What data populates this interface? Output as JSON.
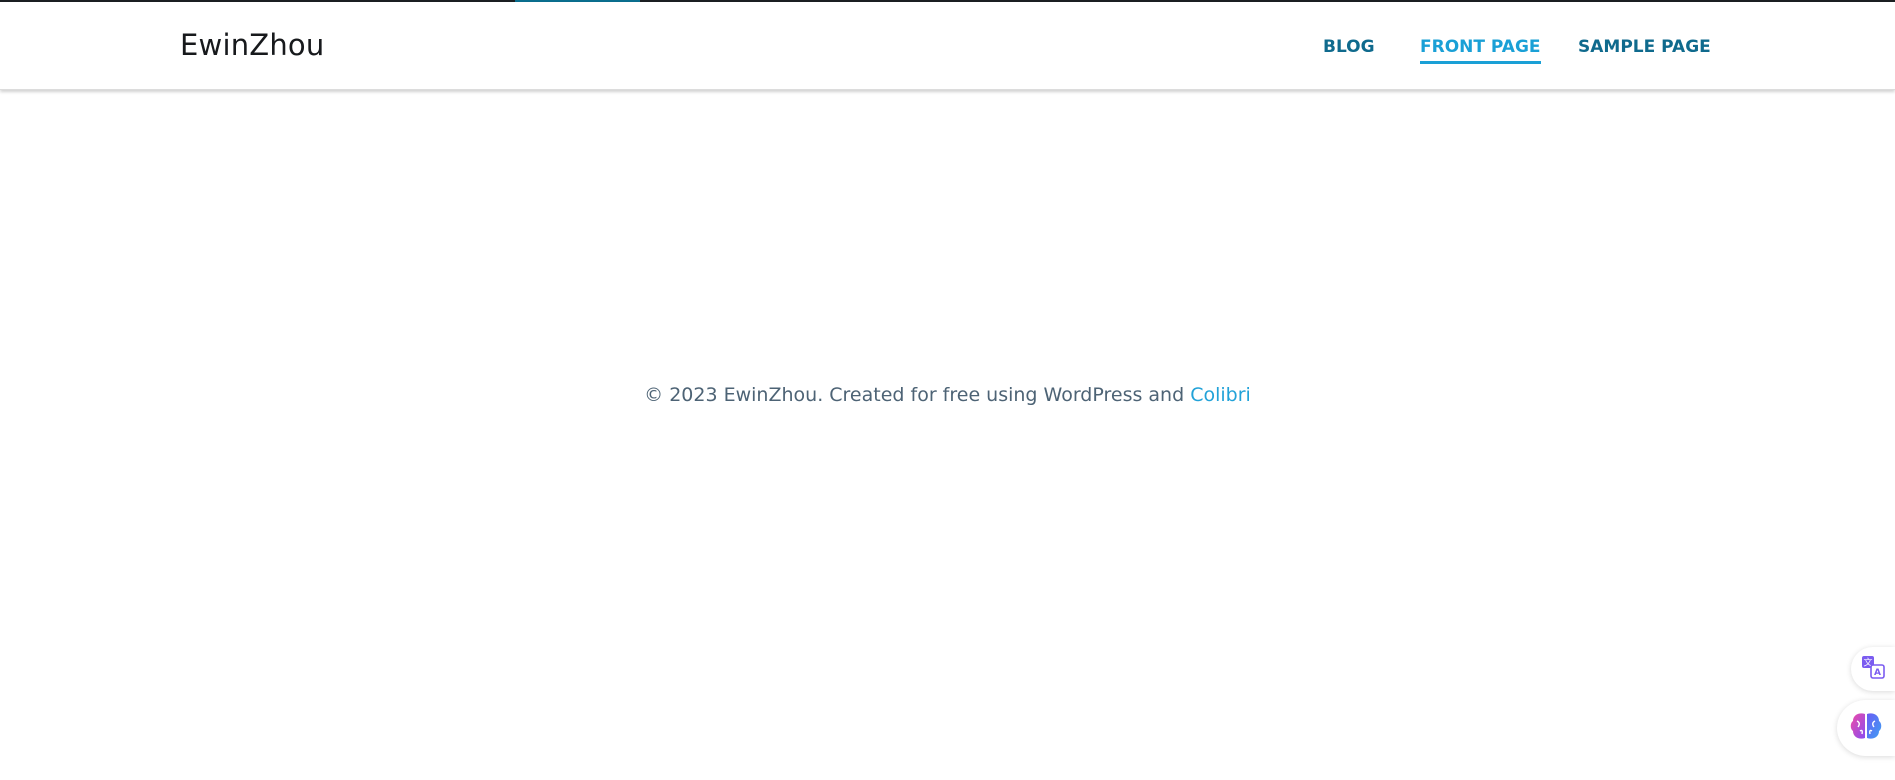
{
  "header": {
    "site_title": "EwinZhou",
    "nav": [
      {
        "label": "BLOG",
        "active": false
      },
      {
        "label": "FRONT PAGE",
        "active": true
      },
      {
        "label": "SAMPLE PAGE",
        "active": false
      }
    ]
  },
  "footer": {
    "copyright": "© 2023 EwinZhou. Created for free using WordPress and ",
    "link_label": "Colibri"
  },
  "floating_buttons": [
    {
      "icon": "translate-icon"
    },
    {
      "icon": "brain-icon"
    }
  ],
  "colors": {
    "nav_text": "#0f6a8d",
    "nav_active": "#1aa0d6",
    "footer_text": "#4d6375",
    "link": "#22a2d8"
  }
}
